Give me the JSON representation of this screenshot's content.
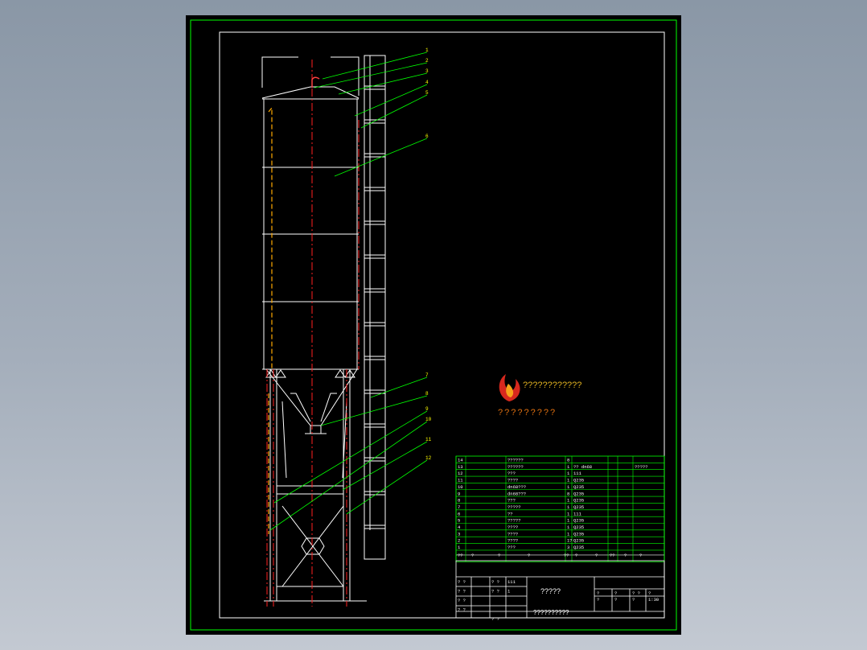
{
  "drawing": {
    "balloons": [
      "1",
      "2",
      "3",
      "4",
      "5",
      "6",
      "7",
      "8",
      "9",
      "10",
      "11",
      "12"
    ],
    "logo": {
      "line1": "????????????",
      "line2": "?????????"
    },
    "parts_table": {
      "rows": [
        {
          "no": "14",
          "name": "??????",
          "qty": "8",
          "material": "",
          "note": ""
        },
        {
          "no": "13",
          "name": "??????",
          "qty": "1",
          "material": "?? dn68",
          "note": "?????"
        },
        {
          "no": "12",
          "name": "???",
          "qty": "1",
          "material": "111",
          "note": ""
        },
        {
          "no": "11",
          "name": "????",
          "qty": "1",
          "material": "Q235",
          "note": ""
        },
        {
          "no": "10",
          "name": "dn68???",
          "qty": "1",
          "material": "Q235",
          "note": ""
        },
        {
          "no": "9",
          "name": "dn68???",
          "qty": "8",
          "material": "Q235",
          "note": ""
        },
        {
          "no": "8",
          "name": "???",
          "qty": "1",
          "material": "Q235",
          "note": ""
        },
        {
          "no": "7",
          "name": "?????",
          "qty": "1",
          "material": "Q235",
          "note": ""
        },
        {
          "no": "6",
          "name": "??",
          "qty": "1",
          "material": "111",
          "note": ""
        },
        {
          "no": "5",
          "name": "?????",
          "qty": "1",
          "material": "Q235",
          "note": ""
        },
        {
          "no": "4",
          "name": "????",
          "qty": "1",
          "material": "Q235",
          "note": ""
        },
        {
          "no": "3",
          "name": "????",
          "qty": "1",
          "material": "Q235",
          "note": ""
        },
        {
          "no": "2",
          "name": "????",
          "qty": "1?",
          "material": "Q235",
          "note": ""
        },
        {
          "no": "1",
          "name": "???",
          "qty": "3",
          "material": "Q235",
          "note": ""
        }
      ],
      "header": [
        "??",
        "?",
        "?",
        "?",
        "??",
        "?",
        "?",
        "??",
        "?",
        "?"
      ]
    },
    "title_block": {
      "left": [
        [
          "? ?",
          "",
          "? ?",
          "111"
        ],
        [
          "? ?",
          "",
          "? ?",
          "1"
        ],
        [
          "? ?",
          "",
          "",
          ""
        ],
        [
          "? ?",
          "",
          "",
          ""
        ],
        [
          "",
          "",
          "? ?",
          ""
        ]
      ],
      "main_title": "?????",
      "right": [
        [
          "?",
          "?",
          "? ?",
          "?"
        ],
        [
          "?",
          "?",
          "?",
          "1:30"
        ]
      ],
      "bottom_title": "??????????"
    }
  }
}
